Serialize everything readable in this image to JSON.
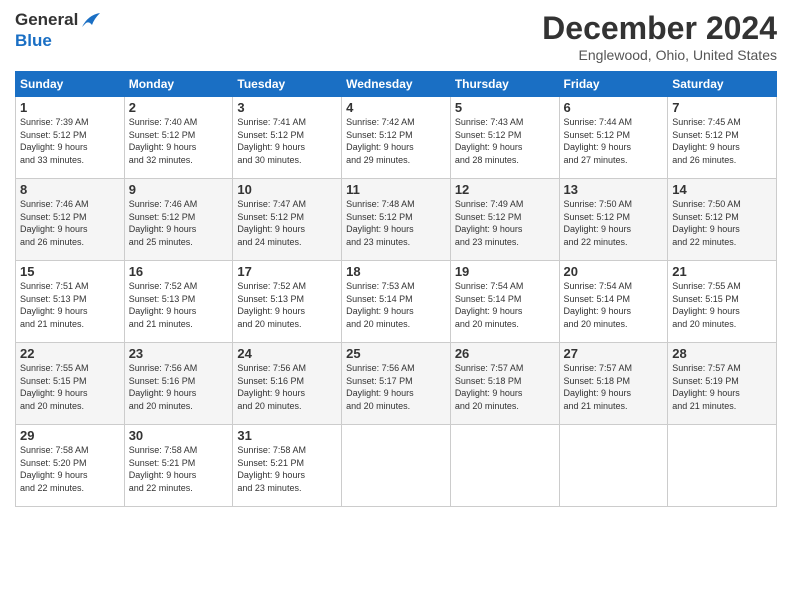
{
  "header": {
    "logo_line1": "General",
    "logo_line2": "Blue",
    "month": "December 2024",
    "location": "Englewood, Ohio, United States"
  },
  "days_of_week": [
    "Sunday",
    "Monday",
    "Tuesday",
    "Wednesday",
    "Thursday",
    "Friday",
    "Saturday"
  ],
  "weeks": [
    [
      {
        "day": "1",
        "info": "Sunrise: 7:39 AM\nSunset: 5:12 PM\nDaylight: 9 hours\nand 33 minutes."
      },
      {
        "day": "2",
        "info": "Sunrise: 7:40 AM\nSunset: 5:12 PM\nDaylight: 9 hours\nand 32 minutes."
      },
      {
        "day": "3",
        "info": "Sunrise: 7:41 AM\nSunset: 5:12 PM\nDaylight: 9 hours\nand 30 minutes."
      },
      {
        "day": "4",
        "info": "Sunrise: 7:42 AM\nSunset: 5:12 PM\nDaylight: 9 hours\nand 29 minutes."
      },
      {
        "day": "5",
        "info": "Sunrise: 7:43 AM\nSunset: 5:12 PM\nDaylight: 9 hours\nand 28 minutes."
      },
      {
        "day": "6",
        "info": "Sunrise: 7:44 AM\nSunset: 5:12 PM\nDaylight: 9 hours\nand 27 minutes."
      },
      {
        "day": "7",
        "info": "Sunrise: 7:45 AM\nSunset: 5:12 PM\nDaylight: 9 hours\nand 26 minutes."
      }
    ],
    [
      {
        "day": "8",
        "info": "Sunrise: 7:46 AM\nSunset: 5:12 PM\nDaylight: 9 hours\nand 26 minutes."
      },
      {
        "day": "9",
        "info": "Sunrise: 7:46 AM\nSunset: 5:12 PM\nDaylight: 9 hours\nand 25 minutes."
      },
      {
        "day": "10",
        "info": "Sunrise: 7:47 AM\nSunset: 5:12 PM\nDaylight: 9 hours\nand 24 minutes."
      },
      {
        "day": "11",
        "info": "Sunrise: 7:48 AM\nSunset: 5:12 PM\nDaylight: 9 hours\nand 23 minutes."
      },
      {
        "day": "12",
        "info": "Sunrise: 7:49 AM\nSunset: 5:12 PM\nDaylight: 9 hours\nand 23 minutes."
      },
      {
        "day": "13",
        "info": "Sunrise: 7:50 AM\nSunset: 5:12 PM\nDaylight: 9 hours\nand 22 minutes."
      },
      {
        "day": "14",
        "info": "Sunrise: 7:50 AM\nSunset: 5:12 PM\nDaylight: 9 hours\nand 22 minutes."
      }
    ],
    [
      {
        "day": "15",
        "info": "Sunrise: 7:51 AM\nSunset: 5:13 PM\nDaylight: 9 hours\nand 21 minutes."
      },
      {
        "day": "16",
        "info": "Sunrise: 7:52 AM\nSunset: 5:13 PM\nDaylight: 9 hours\nand 21 minutes."
      },
      {
        "day": "17",
        "info": "Sunrise: 7:52 AM\nSunset: 5:13 PM\nDaylight: 9 hours\nand 20 minutes."
      },
      {
        "day": "18",
        "info": "Sunrise: 7:53 AM\nSunset: 5:14 PM\nDaylight: 9 hours\nand 20 minutes."
      },
      {
        "day": "19",
        "info": "Sunrise: 7:54 AM\nSunset: 5:14 PM\nDaylight: 9 hours\nand 20 minutes."
      },
      {
        "day": "20",
        "info": "Sunrise: 7:54 AM\nSunset: 5:14 PM\nDaylight: 9 hours\nand 20 minutes."
      },
      {
        "day": "21",
        "info": "Sunrise: 7:55 AM\nSunset: 5:15 PM\nDaylight: 9 hours\nand 20 minutes."
      }
    ],
    [
      {
        "day": "22",
        "info": "Sunrise: 7:55 AM\nSunset: 5:15 PM\nDaylight: 9 hours\nand 20 minutes."
      },
      {
        "day": "23",
        "info": "Sunrise: 7:56 AM\nSunset: 5:16 PM\nDaylight: 9 hours\nand 20 minutes."
      },
      {
        "day": "24",
        "info": "Sunrise: 7:56 AM\nSunset: 5:16 PM\nDaylight: 9 hours\nand 20 minutes."
      },
      {
        "day": "25",
        "info": "Sunrise: 7:56 AM\nSunset: 5:17 PM\nDaylight: 9 hours\nand 20 minutes."
      },
      {
        "day": "26",
        "info": "Sunrise: 7:57 AM\nSunset: 5:18 PM\nDaylight: 9 hours\nand 20 minutes."
      },
      {
        "day": "27",
        "info": "Sunrise: 7:57 AM\nSunset: 5:18 PM\nDaylight: 9 hours\nand 21 minutes."
      },
      {
        "day": "28",
        "info": "Sunrise: 7:57 AM\nSunset: 5:19 PM\nDaylight: 9 hours\nand 21 minutes."
      }
    ],
    [
      {
        "day": "29",
        "info": "Sunrise: 7:58 AM\nSunset: 5:20 PM\nDaylight: 9 hours\nand 22 minutes."
      },
      {
        "day": "30",
        "info": "Sunrise: 7:58 AM\nSunset: 5:21 PM\nDaylight: 9 hours\nand 22 minutes."
      },
      {
        "day": "31",
        "info": "Sunrise: 7:58 AM\nSunset: 5:21 PM\nDaylight: 9 hours\nand 23 minutes."
      },
      {
        "day": "",
        "info": ""
      },
      {
        "day": "",
        "info": ""
      },
      {
        "day": "",
        "info": ""
      },
      {
        "day": "",
        "info": ""
      }
    ]
  ]
}
